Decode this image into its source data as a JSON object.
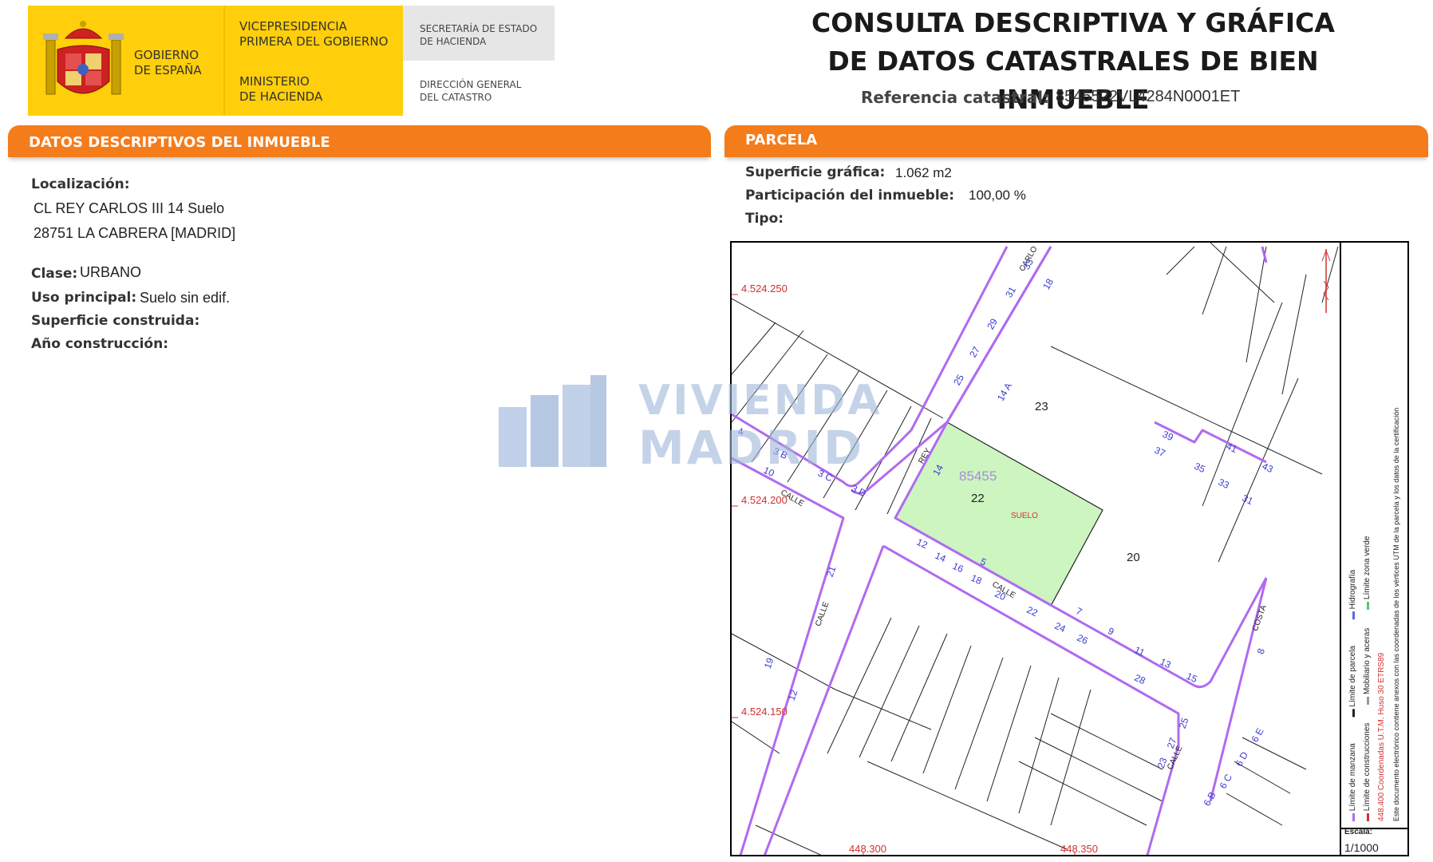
{
  "header": {
    "gobierno": "GOBIERNO\nDE ESPAÑA",
    "vicepresidencia": "VICEPRESIDENCIA\nPRIMERA DEL GOBIERNO",
    "ministerio": "MINISTERIO\nDE HACIENDA",
    "secretaria": "SECRETARÍA DE ESTADO\nDE HACIENDA",
    "direccion": "DIRECCIÓN GENERAL\nDEL CATASTRO",
    "title_line1": "CONSULTA DESCRIPTIVA Y GRÁFICA",
    "title_line2": "DE DATOS CATASTRALES DE BIEN INMUEBLE",
    "ref_label": "Referencia catastral:",
    "ref_value": "8545522VL4284N0001ET"
  },
  "descriptivos": {
    "section_title": "DATOS DESCRIPTIVOS DEL INMUEBLE",
    "localizacion_label": "Localización:",
    "address_line1": "CL REY CARLOS III 14 Suelo",
    "address_line2": "28751 LA CABRERA [MADRID]",
    "clase_label": "Clase:",
    "clase_value": "URBANO",
    "uso_label": "Uso principal:",
    "uso_value": "Suelo sin edif.",
    "superficie_label": "Superficie construida:",
    "anio_label": "Año construcción:"
  },
  "parcela": {
    "section_title": "PARCELA",
    "superficie_label": "Superficie gráfica:",
    "superficie_value": "1.062 m2",
    "participacion_label": "Participación del inmueble:",
    "participacion_value": "100,00 %",
    "tipo_label": "Tipo:"
  },
  "watermark": {
    "line1": "VIVIENDA",
    "line2": "MADRID"
  },
  "map": {
    "coord_labels": [
      "4.524.250",
      "4.524.200",
      "4.524.150",
      "448.300",
      "448.350"
    ],
    "block_number": "85455",
    "parcel_numbers": [
      "23",
      "22",
      "20"
    ],
    "parcel_tag": "SUELO",
    "street_labels": [
      "CARLO",
      "REY",
      "CALLE",
      "CALLE",
      "CALLE",
      "COSTA",
      "CALLE"
    ],
    "house_numbers_blue": [
      "33",
      "31",
      "29",
      "27",
      "25",
      "14 A",
      "18",
      "14",
      "3 B",
      "3 C",
      "3 D",
      "10",
      "4",
      "12",
      "14",
      "16",
      "18",
      "20",
      "22",
      "24",
      "26",
      "5",
      "7",
      "9",
      "11",
      "13",
      "15",
      "28",
      "39",
      "37",
      "35",
      "33",
      "31",
      "41",
      "43",
      "21",
      "19",
      "12",
      "25",
      "27",
      "23",
      "6 B",
      "6 C",
      "6 D",
      "6 E",
      "8"
    ],
    "legend": {
      "limite_manzana": "Límite de manzana",
      "limite_parcela": "Límite de parcela",
      "hidrografia": "Hidrografía",
      "limite_construcciones": "Límite de construcciones",
      "mobiliario": "Mobiliario y aceras",
      "zona_verde": "Límite zona verde",
      "coordenadas": "448.400 Coordenadas U.T.M. Huso 30 ETRS89",
      "certificacion": "Este documento electrónico contiene anexos con las coordenadas de los vértices UTM de la parcela y los datos de la certificación"
    },
    "escala_label": "Escala:",
    "escala_value": "1/1000"
  },
  "colors": {
    "yellow": "#fecf0a",
    "orange": "#f57c1a",
    "parcel_green": "#ccf5c0",
    "street_purple": "#b06af0",
    "number_blue": "#3a3ad0",
    "coord_red": "#d23030"
  }
}
